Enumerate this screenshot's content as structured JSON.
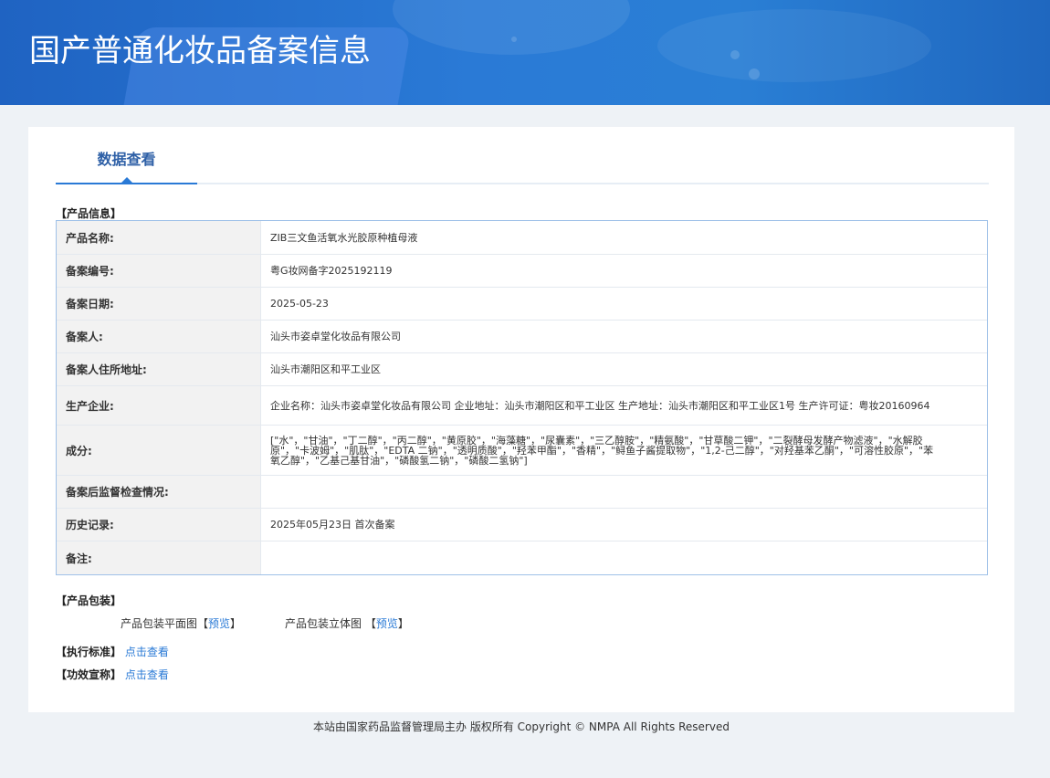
{
  "banner": {
    "title": "国产普通化妆品备案信息"
  },
  "tabs": [
    {
      "label": "数据查看",
      "active": true
    }
  ],
  "product_info": {
    "section_title": "【产品信息】",
    "rows": [
      {
        "key": "产品名称:",
        "value": "ZIB三文鱼活氧水光胶原种植母液"
      },
      {
        "key": "备案编号:",
        "value": "粤G妆网备字2025192119"
      },
      {
        "key": "备案日期:",
        "value": "2025-05-23"
      },
      {
        "key": "备案人:",
        "value": "汕头市姿卓堂化妆品有限公司"
      },
      {
        "key": "备案人住所地址:",
        "value": "汕头市潮阳区和平工业区"
      },
      {
        "key": "生产企业:",
        "value": "企业名称：汕头市姿卓堂化妆品有限公司 企业地址：汕头市潮阳区和平工业区 生产地址：汕头市潮阳区和平工业区1号 生产许可证：粤妆20160964"
      },
      {
        "key": "成分:",
        "value": "[\"水\"，\"甘油\"，\"丁二醇\"，\"丙二醇\"，\"黄原胶\"，\"海藻糖\"，\"尿囊素\"，\"三乙醇胺\"，\"精氨酸\"，\"甘草酸二钾\"，\"二裂酵母发酵产物滤液\"，\"水解胶原\"，\"卡波姆\"，\"肌肽\"，\"EDTA 二钠\"，\"透明质酸\"，\"羟苯甲酯\"，\"香精\"，\"鲟鱼子酱提取物\"，\"1,2-己二醇\"，\"对羟基苯乙酮\"，\"可溶性胶原\"，\"苯氧乙醇\"，\"乙基己基甘油\"，\"磷酸氢二钠\"，\"磷酸二氢钠\"]"
      },
      {
        "key": "备案后监督检查情况:",
        "value": ""
      },
      {
        "key": "历史记录:",
        "value": "2025年05月23日 首次备案"
      },
      {
        "key": "备注:",
        "value": ""
      }
    ]
  },
  "packaging": {
    "section_title": "【产品包装】",
    "flat_label": "产品包装平面图",
    "flat_link": "预览",
    "solid_label": "产品包装立体图",
    "solid_link": "预览",
    "bracket_open": "【",
    "bracket_close": "】"
  },
  "standard": {
    "label": "【执行标准】",
    "link": "点击查看"
  },
  "efficacy": {
    "label": "【功效宣称】",
    "link": "点击查看"
  },
  "footer": {
    "text": "本站由国家药品监督管理局主办 版权所有 Copyright © NMPA All Rights Reserved"
  }
}
